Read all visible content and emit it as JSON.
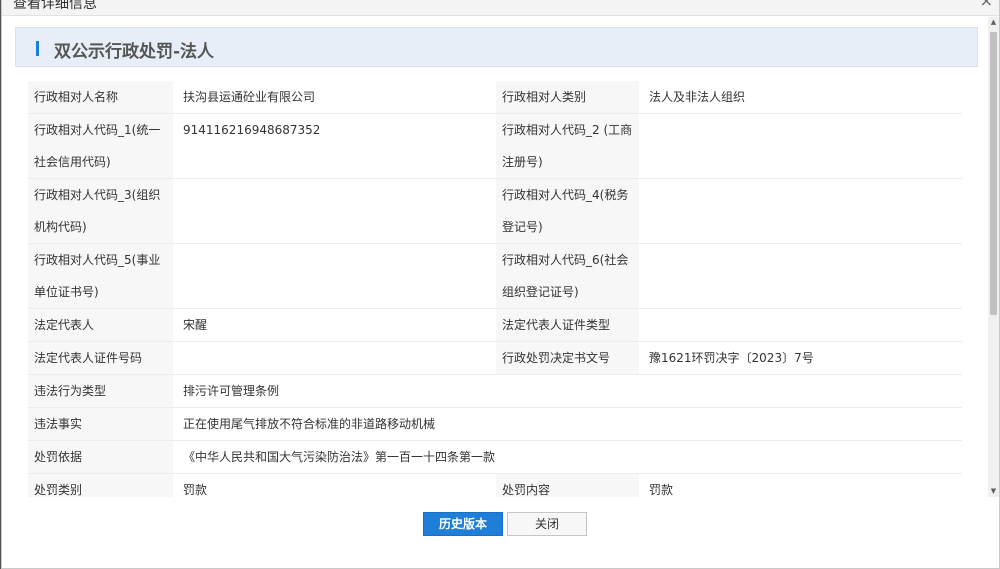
{
  "dialog": {
    "title": "查看详细信息",
    "close_glyph": "×"
  },
  "section": {
    "title": "双公示行政处罚-法人"
  },
  "rows": [
    {
      "l1": "行政相对人名称",
      "v1": "扶沟县运通砼业有限公司",
      "l2": "行政相对人类别",
      "v2": "法人及非法人组织"
    },
    {
      "l1a": "行政相对人代码_1(统一",
      "l1b": "社会信用代码)",
      "v1": "914116216948687352",
      "l2a": "行政相对人代码_2 (工商",
      "l2b": "注册号)",
      "v2": ""
    },
    {
      "l1a": "行政相对人代码_3(组织",
      "l1b": "机构代码)",
      "v1": "",
      "l2a": "行政相对人代码_4(税务",
      "l2b": "登记号)",
      "v2": ""
    },
    {
      "l1a": "行政相对人代码_5(事业",
      "l1b": "单位证书号)",
      "v1": "",
      "l2a": "行政相对人代码_6(社会",
      "l2b": "组织登记证号)",
      "v2": ""
    },
    {
      "l1": "法定代表人",
      "v1": "宋醒",
      "l2": "法定代表人证件类型",
      "v2": ""
    },
    {
      "l1": "法定代表人证件号码",
      "v1": "",
      "l2": "行政处罚决定书文号",
      "v2": "豫1621环罚决字〔2023〕7号"
    },
    {
      "l1": "违法行为类型",
      "v1": "排污许可管理条例"
    },
    {
      "l1": "违法事实",
      "v1": "正在使用尾气排放不符合标准的非道路移动机械"
    },
    {
      "l1": "处罚依据",
      "v1": "《中华人民共和国大气污染防治法》第一百一十四条第一款"
    },
    {
      "l1": "处罚类别",
      "v1": "罚款",
      "l2": "处罚内容",
      "v2": "罚款"
    }
  ],
  "buttons": {
    "history": "历史版本",
    "close": "关闭"
  },
  "colors": {
    "accent": "#1e7ed8",
    "header_bg": "#e7eef7",
    "label_bg": "#f7f7f7"
  }
}
